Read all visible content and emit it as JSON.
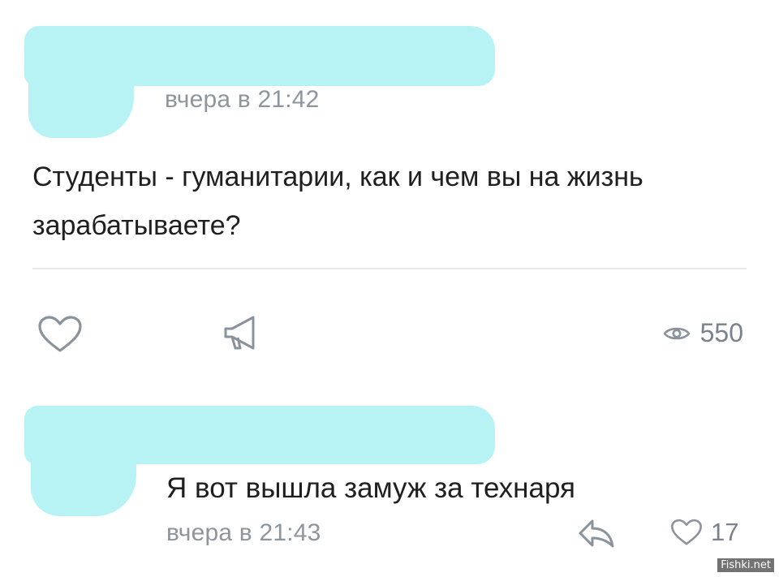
{
  "post": {
    "time": "вчера в 21:42",
    "text": "Студенты - гуманитарии, как и чем вы на жизнь зарабатываете?",
    "actions": {
      "like_icon": "heart-icon",
      "share_icon": "megaphone-icon",
      "views_icon": "eye-icon",
      "views_count": "550"
    }
  },
  "comment": {
    "text": "Я вот вышла замуж за технаря",
    "time": "вчера в 21:43",
    "reply_icon": "reply-icon",
    "like_icon": "heart-icon",
    "likes": "17"
  },
  "watermark": "Fishki.net",
  "colors": {
    "redaction": "#b7f3f4",
    "meta": "#8d959d",
    "icon": "#8a939c",
    "text": "#1f1f1f"
  }
}
